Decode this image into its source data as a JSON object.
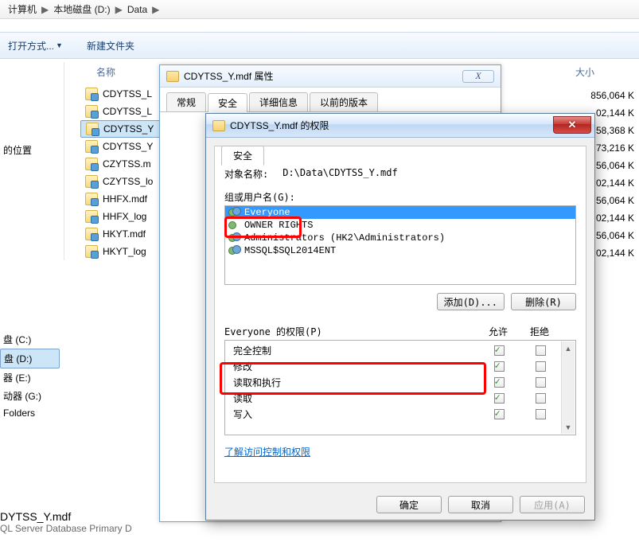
{
  "breadcrumb": [
    "计算机",
    "本地磁盘 (D:)",
    "Data"
  ],
  "toolbar": {
    "open_with": "打开方式...",
    "new_folder": "新建文件夹"
  },
  "columns": {
    "name": "名称",
    "size": "大小"
  },
  "nav": {
    "items": [
      {
        "label": "的位置"
      },
      {
        "label": "盘 (C:)"
      },
      {
        "label": "盘 (D:)",
        "selected": true
      },
      {
        "label": "器 (E:)"
      },
      {
        "label": "动器 (G:)"
      },
      {
        "label": "Folders"
      }
    ]
  },
  "files": [
    {
      "name": "CDYTSS_L",
      "size": "856,064 K"
    },
    {
      "name": "CDYTSS_L",
      "size": "02,144 K"
    },
    {
      "name": "CDYTSS_Y",
      "size": "58,368 K",
      "selected": true
    },
    {
      "name": "CDYTSS_Y",
      "size": "73,216 K"
    },
    {
      "name": "CZYTSS.m",
      "size": "56,064 K"
    },
    {
      "name": "CZYTSS_lo",
      "size": "02,144 K"
    },
    {
      "name": "HHFX.mdf",
      "size": "56,064 K"
    },
    {
      "name": "HHFX_log",
      "size": "02,144 K"
    },
    {
      "name": "HKYT.mdf",
      "size": "56,064 K"
    },
    {
      "name": "HKYT_log",
      "size": "02,144 K"
    }
  ],
  "props_window": {
    "title": "CDYTSS_Y.mdf 属性",
    "tabs": [
      "常规",
      "安全",
      "详细信息",
      "以前的版本"
    ],
    "active_tab": "安全"
  },
  "perm_window": {
    "title": "CDYTSS_Y.mdf 的权限",
    "tab": "安全",
    "object_label": "对象名称:",
    "object_path": "D:\\Data\\CDYTSS_Y.mdf",
    "group_label": "组或用户名(G):",
    "users": [
      {
        "name": "Everyone",
        "selected": true
      },
      {
        "name": "OWNER RIGHTS"
      },
      {
        "name": "Administrators (HK2\\Administrators)"
      },
      {
        "name": "MSSQL$SQL2014ENT"
      }
    ],
    "add_btn": "添加(D)...",
    "remove_btn": "删除(R)",
    "perm_for_label": "Everyone 的权限(P)",
    "allow_label": "允许",
    "deny_label": "拒绝",
    "perms": [
      {
        "name": "完全控制",
        "allow": true,
        "deny": false
      },
      {
        "name": "修改",
        "allow": true,
        "deny": false
      },
      {
        "name": "读取和执行",
        "allow": true,
        "deny": false
      },
      {
        "name": "读取",
        "allow": true,
        "deny": false
      },
      {
        "name": "写入",
        "allow": true,
        "deny": false
      }
    ],
    "link": "了解访问控制和权限",
    "ok": "确定",
    "cancel": "取消",
    "apply": "应用(A)"
  },
  "bottom": {
    "filename": "DYTSS_Y.mdf",
    "filetype": "QL Server Database Primary D"
  }
}
